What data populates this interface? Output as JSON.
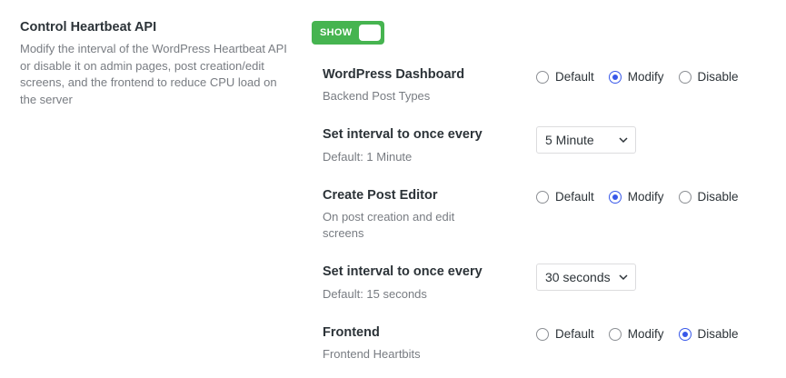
{
  "section": {
    "title": "Control Heartbeat API",
    "description": "Modify the interval of the WordPress Heartbeat API or disable it on admin pages, post creation/edit screens, and the frontend to reduce CPU load on the server"
  },
  "toggle": {
    "label": "SHOW",
    "on": true,
    "color": "#46b450"
  },
  "accent_color": "#3858e9",
  "rows": [
    {
      "title": "WordPress Dashboard",
      "description": "Backend Post Types",
      "options": [
        "Default",
        "Modify",
        "Disable"
      ],
      "selected": "Modify"
    },
    {
      "title": "Set interval to once every",
      "description": "Default: 1 Minute",
      "select_value": "5 Minute"
    },
    {
      "title": "Create Post Editor",
      "description": "On post creation and edit screens",
      "options": [
        "Default",
        "Modify",
        "Disable"
      ],
      "selected": "Modify"
    },
    {
      "title": "Set interval to once every",
      "description": "Default: 15 seconds",
      "select_value": "30 seconds"
    },
    {
      "title": "Frontend",
      "description": "Frontend Heartbits",
      "options": [
        "Default",
        "Modify",
        "Disable"
      ],
      "selected": "Disable"
    }
  ]
}
